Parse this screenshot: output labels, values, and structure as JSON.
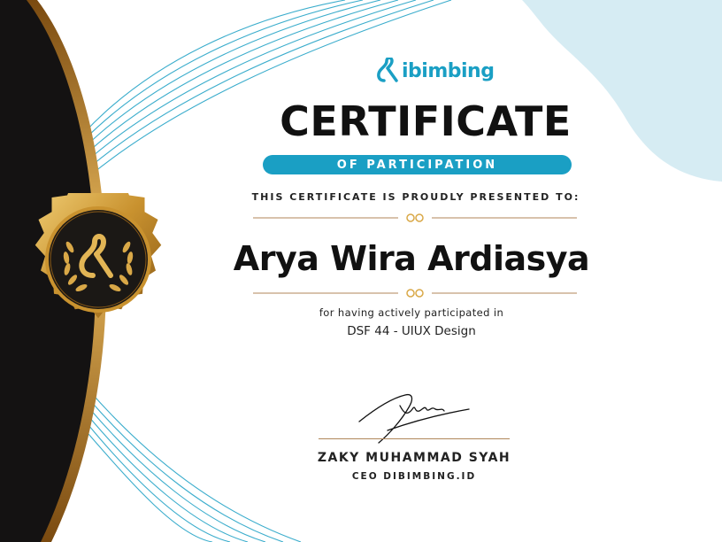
{
  "brand": {
    "name": "ibimbing",
    "color": "#1a9fc4"
  },
  "certificate": {
    "title": "CERTIFICATE",
    "subtitle": "OF PARTICIPATION",
    "presented_to": "THIS CERTIFICATE IS PROUDLY PRESENTED TO:",
    "recipient_name": "Arya Wira Ardiasya",
    "reason": "for having actively participated in",
    "program": "DSF 44 - UIUX Design"
  },
  "signatory": {
    "name": "ZAKY MUHAMMAD SYAH",
    "title": "CEO DIBIMBING.ID"
  },
  "colors": {
    "accent": "#1a9fc4",
    "gold": "#c9922f",
    "dark": "#141212",
    "light_blue_blob": "#d6ecf3"
  },
  "icons": {
    "logo": "dibimbing-logo-icon",
    "seal": "gold-seal-badge-icon",
    "divider_ornament": "double-ring-ornament-icon"
  }
}
